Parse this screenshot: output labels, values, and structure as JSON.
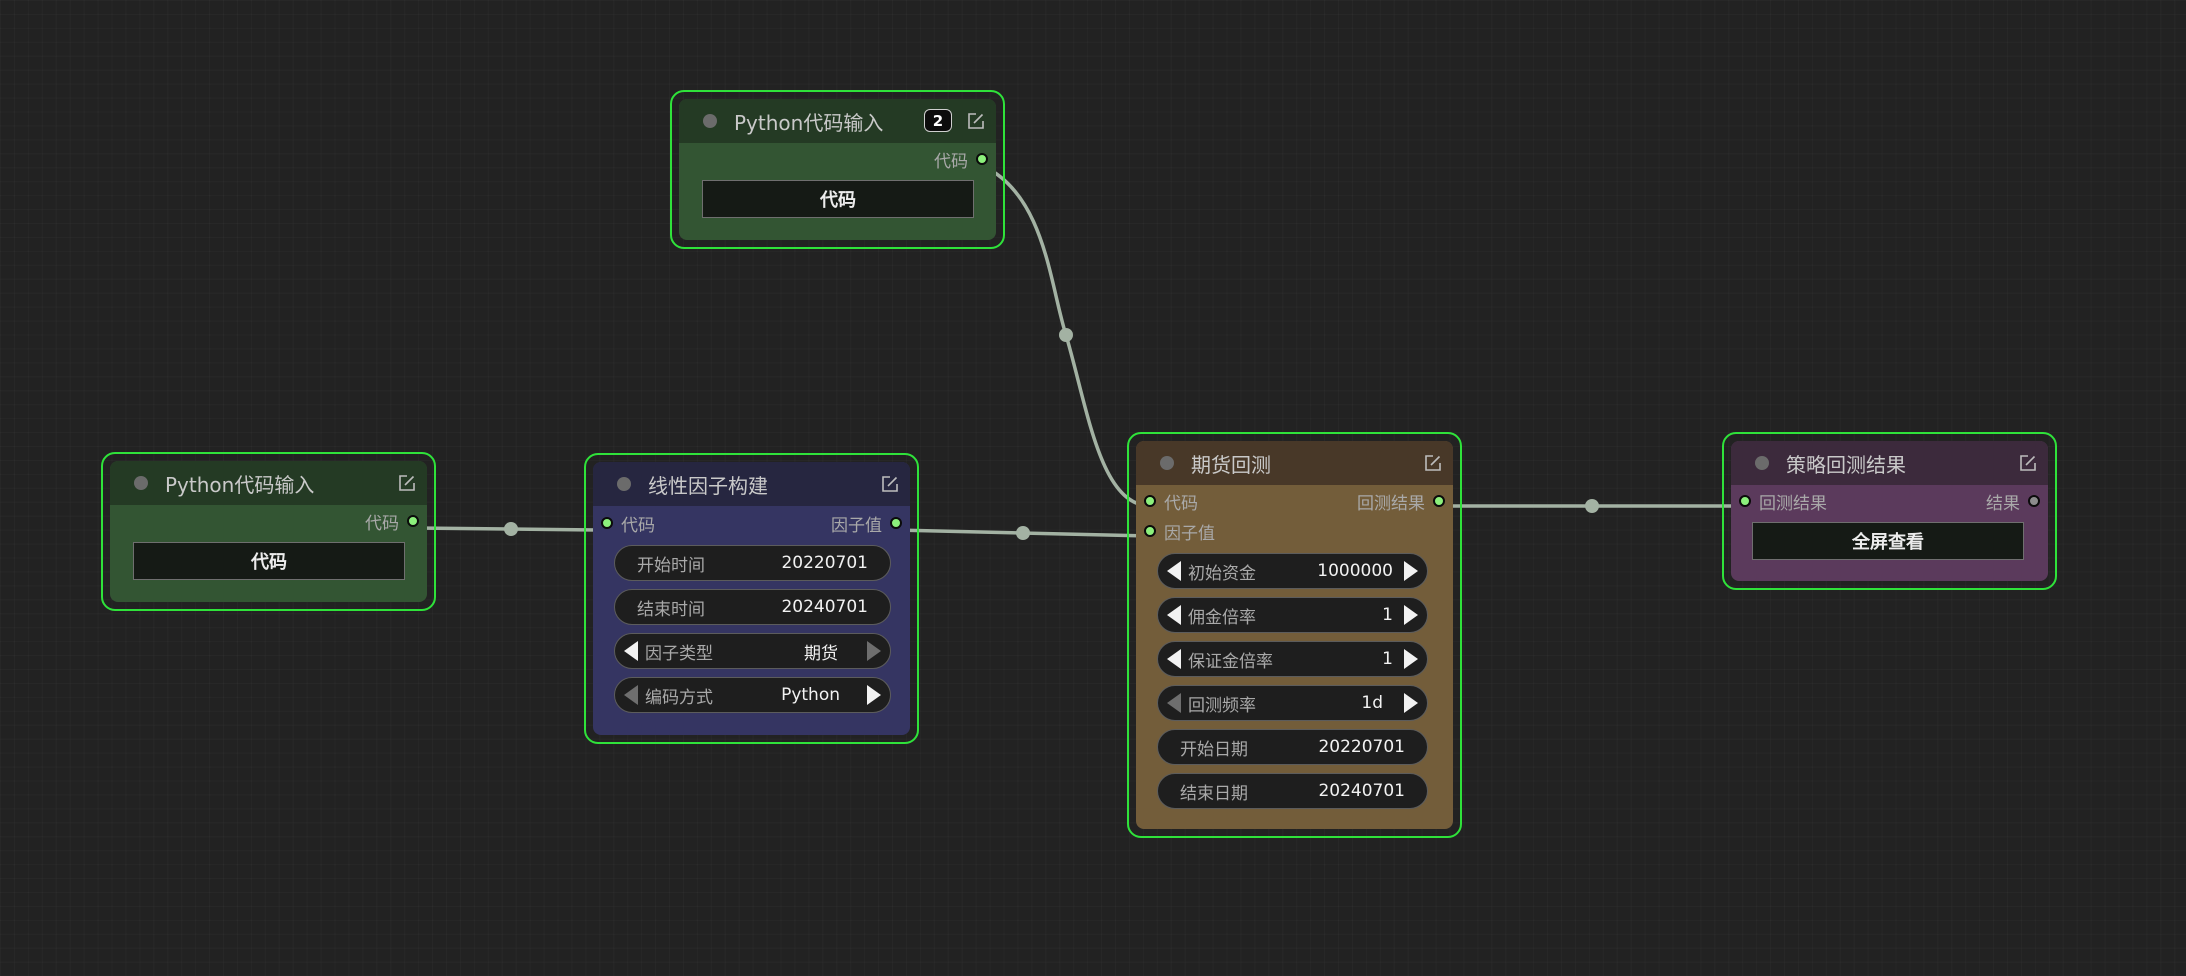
{
  "nodes": {
    "python_input_1": {
      "title": "Python代码输入",
      "output_label": "代码",
      "button_label": "代码"
    },
    "python_input_2": {
      "title": "Python代码输入",
      "badge": "2",
      "output_label": "代码",
      "button_label": "代码"
    },
    "linear_factor": {
      "title": "线性因子构建",
      "input_label": "代码",
      "output_label": "因子值",
      "fields": [
        {
          "label": "开始时间",
          "value": "20220701"
        },
        {
          "label": "结束时间",
          "value": "20240701"
        },
        {
          "label": "因子类型",
          "value": "期货"
        },
        {
          "label": "编码方式",
          "value": "Python"
        }
      ]
    },
    "futures_backtest": {
      "title": "期货回测",
      "inputs": [
        "代码",
        "因子值"
      ],
      "output_label": "回测结果",
      "fields": [
        {
          "label": "初始资金",
          "value": "1000000"
        },
        {
          "label": "佣金倍率",
          "value": "1"
        },
        {
          "label": "保证金倍率",
          "value": "1"
        },
        {
          "label": "回测频率",
          "value": "1d"
        },
        {
          "label": "开始日期",
          "value": "20220701"
        },
        {
          "label": "结束日期",
          "value": "20240701"
        }
      ]
    },
    "strategy_result": {
      "title": "策略回测结果",
      "input_label": "回测结果",
      "output_label": "结果",
      "button_label": "全屏查看"
    }
  },
  "colors": {
    "canvas_bg": "#222222",
    "selection_outline": "#2fe23a",
    "python_node_header": "#243a24",
    "python_node_body": "#335533",
    "factor_node_header": "#262640",
    "factor_node_body": "#353562",
    "backtest_node_header": "#483828",
    "backtest_node_body": "#735d3a",
    "result_node_header": "#3c2a3c",
    "result_node_body": "#5b3a5c",
    "wire": "#a3b2a3",
    "connected_pin": "#8cf07c",
    "unconnected_pin": "#8c8c8c"
  },
  "icons": {
    "title_dot": "node-status-dot",
    "edit": "edit-icon"
  }
}
